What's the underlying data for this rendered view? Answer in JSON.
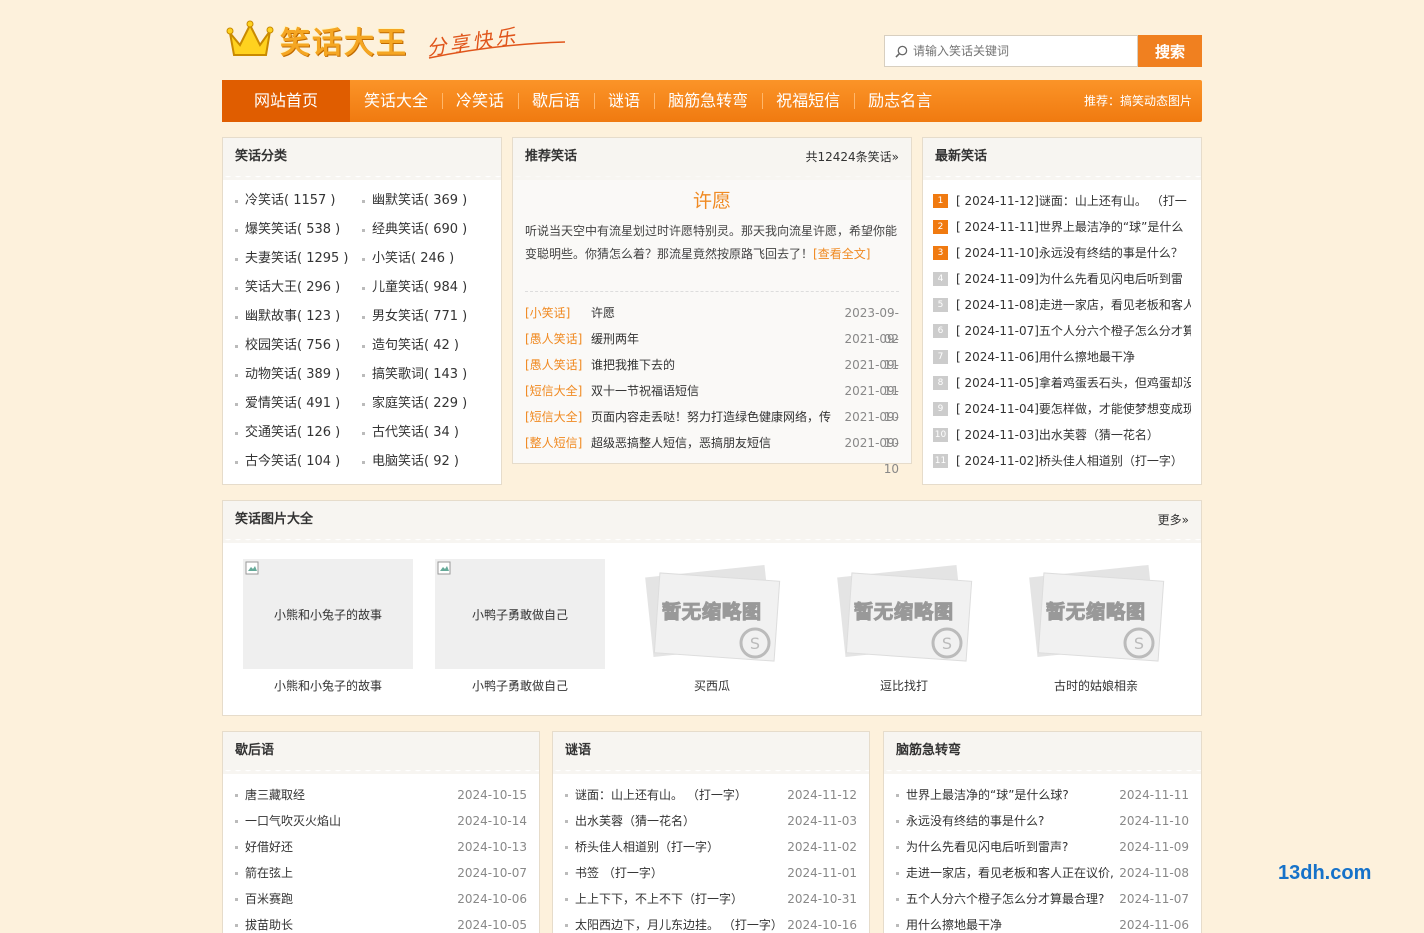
{
  "header": {
    "logo_text": "笑话大王",
    "slogan": "分享快乐",
    "search_placeholder": "请输入笑话关键词",
    "search_button": "搜索"
  },
  "nav": {
    "items": [
      "网站首页",
      "笑话大全",
      "冷笑话",
      "歇后语",
      "谜语",
      "脑筋急转弯",
      "祝福短信",
      "励志名言"
    ],
    "recommend": "推荐：搞笑动态图片"
  },
  "categories": {
    "title": "笑话分类",
    "items": [
      "冷笑话( 1157 )",
      "幽默笑话( 369 )",
      "爆笑笑话( 538 )",
      "经典笑话( 690 )",
      "夫妻笑话( 1295 )",
      "小笑话( 246 )",
      "笑话大王( 296 )",
      "儿童笑话( 984 )",
      "幽默故事( 123 )",
      "男女笑话( 771 )",
      "校园笑话( 756 )",
      "造句笑话( 42 )",
      "动物笑话( 389 )",
      "搞笑歌词( 143 )",
      "爱情笑话( 491 )",
      "家庭笑话( 229 )",
      "交通笑话( 126 )",
      "古代笑话( 34 )",
      "古今笑话( 104 )",
      "电脑笑话( 92 )"
    ]
  },
  "recommend": {
    "title": "推荐笑话",
    "count": "共12424条笑话»",
    "joke_title": "许愿",
    "joke_body": "听说当天空中有流星划过时许愿特别灵。那天我向流星许愿，希望你能变聪明些。你猜怎么着？那流星竟然按原路飞回去了！",
    "read_more": "[查看全文]",
    "list": [
      {
        "tag": "[小笑话]",
        "title": "许愿",
        "date": "2023-09-02"
      },
      {
        "tag": "[愚人笑话]",
        "title": "缓刑两年",
        "date": "2021-09-11"
      },
      {
        "tag": "[愚人笑话]",
        "title": "谁把我推下去的",
        "date": "2021-09-11"
      },
      {
        "tag": "[短信大全]",
        "title": "双十一节祝福语短信",
        "date": "2021-09-10"
      },
      {
        "tag": "[短信大全]",
        "title": "页面内容走丢哒！努力打造绿色健康网络，传",
        "date": "2021-09-10"
      },
      {
        "tag": "[整人短信]",
        "title": "超级恶搞整人短信，恶搞朋友短信",
        "date": "2021-09-10"
      }
    ]
  },
  "latest": {
    "title": "最新笑话",
    "items": [
      "[ 2024-11-12]谜面：山上还有山。 （打一",
      "[ 2024-11-11]世界上最洁净的“球”是什么",
      "[ 2024-11-10]永远没有终结的事是什么？",
      "[ 2024-11-09]为什么先看见闪电后听到雷",
      "[ 2024-11-08]走进一家店，看见老板和客人",
      "[ 2024-11-07]五个人分六个橙子怎么分才算",
      "[ 2024-11-06]用什么擦地最干净",
      "[ 2024-11-05]拿着鸡蛋丢石头，但鸡蛋却没",
      "[ 2024-11-04]要怎样做，才能使梦想变成现",
      "[ 2024-11-03]出水芙蓉（猜一花名）",
      "[ 2024-11-02]桥头佳人相道别（打一字）"
    ],
    "numbers": [
      "1",
      "2",
      "3",
      "4",
      "5",
      "6",
      "7",
      "8",
      "9",
      "10",
      "11"
    ]
  },
  "pictures": {
    "title": "笑话图片大全",
    "more": "更多»",
    "items": [
      {
        "alt": "小熊和小兔子的故事",
        "caption": "小熊和小兔子的故事",
        "placeholder": ""
      },
      {
        "alt": "小鸭子勇敢做自己",
        "caption": "小鸭子勇敢做自己",
        "placeholder": ""
      },
      {
        "alt": "",
        "caption": "买西瓜",
        "placeholder": "暂无缩略图"
      },
      {
        "alt": "",
        "caption": "逗比找打",
        "placeholder": "暂无缩略图"
      },
      {
        "alt": "",
        "caption": "古时的姑娘相亲",
        "placeholder": "暂无缩略图"
      }
    ]
  },
  "xiehouyu": {
    "title": "歇后语",
    "items": [
      {
        "t": "唐三藏取经",
        "d": "2024-10-15"
      },
      {
        "t": "一口气吹灭火焰山",
        "d": "2024-10-14"
      },
      {
        "t": "好借好还",
        "d": "2024-10-13"
      },
      {
        "t": "箭在弦上",
        "d": "2024-10-07"
      },
      {
        "t": "百米赛跑",
        "d": "2024-10-06"
      },
      {
        "t": "拔苗助长",
        "d": "2024-10-05"
      }
    ]
  },
  "miyu": {
    "title": "谜语",
    "items": [
      {
        "t": "谜面：山上还有山。 （打一字）",
        "d": "2024-11-12"
      },
      {
        "t": "出水芙蓉（猜一花名）",
        "d": "2024-11-03"
      },
      {
        "t": "桥头佳人相道别（打一字）",
        "d": "2024-11-02"
      },
      {
        "t": "书签 （打一字）",
        "d": "2024-11-01"
      },
      {
        "t": "上上下下，不上不下（打一字）",
        "d": "2024-10-31"
      },
      {
        "t": "太阳西边下，月儿东边挂。 （打一字）",
        "d": "2024-10-16"
      }
    ]
  },
  "naojin": {
    "title": "脑筋急转弯",
    "items": [
      {
        "t": "世界上最洁净的“球”是什么球?",
        "d": "2024-11-11"
      },
      {
        "t": "永远没有终结的事是什么?",
        "d": "2024-11-10"
      },
      {
        "t": "为什么先看见闪电后听到雷声?",
        "d": "2024-11-09"
      },
      {
        "t": "走进一家店，看见老板和客人正在议价,",
        "d": "2024-11-08"
      },
      {
        "t": "五个人分六个橙子怎么分才算最合理?",
        "d": "2024-11-07"
      },
      {
        "t": "用什么擦地最干净",
        "d": "2024-11-06"
      }
    ]
  },
  "watermark": "13dh.com"
}
